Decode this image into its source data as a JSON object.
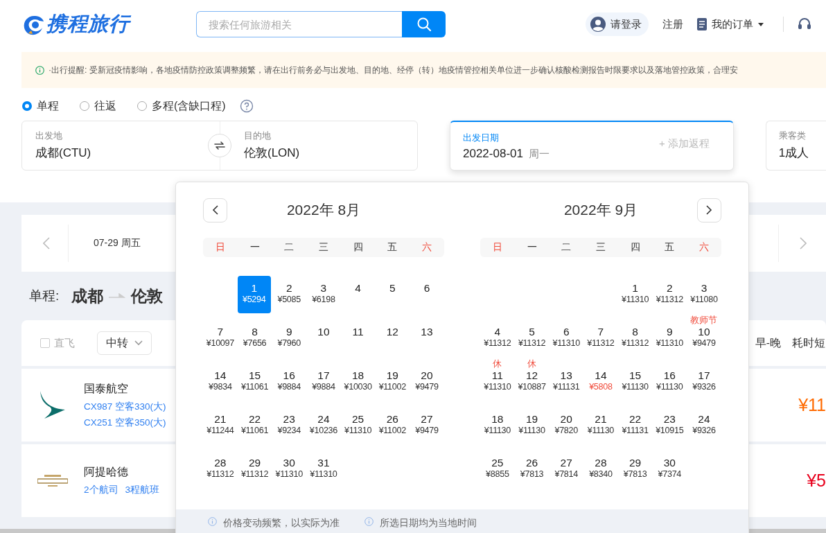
{
  "header": {
    "logo_text": "携程旅行",
    "search": {
      "placeholder": "搜索任何旅游相关"
    },
    "nav": [
      {
        "kind": "login",
        "label": "请登录"
      },
      {
        "kind": "plain",
        "label": "注册"
      },
      {
        "kind": "orders",
        "label": "我的订单"
      }
    ]
  },
  "notice": "·出行提醒: 受新冠疫情影响，各地疫情防控政策调整频繁，请在出行前务必与出发地、目的地、经停（转）地疫情管控相关单位进一步确认核酸检测报告时限要求以及落地管控政策，合理安",
  "trip_types": [
    {
      "label": "单程",
      "selected": true
    },
    {
      "label": "往返",
      "selected": false
    },
    {
      "label": "多程(含缺口程)",
      "selected": false
    }
  ],
  "search_form": {
    "from": {
      "label": "出发地",
      "value": "成都(CTU)"
    },
    "to": {
      "label": "目的地",
      "value": "伦敦(LON)"
    },
    "date": {
      "label": "出发日期",
      "value": "2022-08-01",
      "weekday": "周一",
      "add_return": "+ 添加返程"
    },
    "passengers": {
      "label": "乘客类",
      "value": "1成人"
    }
  },
  "date_strip": [
    {
      "date": "07-29 周五"
    }
  ],
  "route_heading": {
    "prefix": "单程:",
    "from": "成都",
    "to": "伦敦"
  },
  "filters": {
    "direct": {
      "label": "直飞",
      "checked": false
    },
    "dropdowns": [
      {
        "label": "中转"
      }
    ],
    "sorts": [
      {
        "label": "早-晚"
      },
      {
        "label": "耗时短"
      }
    ]
  },
  "results": [
    {
      "kind": "cathay",
      "airline": "国泰航空",
      "links": [
        "CX987 空客330(大)",
        "CX251 空客350(大)"
      ],
      "price": "¥11",
      "color": "#ff6a00"
    },
    {
      "kind": "etihad",
      "airline": "阿提哈德",
      "links": [
        "2个航司",
        "3程航班"
      ],
      "price": "¥5",
      "color": "#e8001c"
    }
  ],
  "calendar": {
    "months": [
      {
        "title": "2022年 8月",
        "kind": "prev",
        "weekdays": [
          "日",
          "一",
          "二",
          "三",
          "四",
          "五",
          "六"
        ],
        "days": [
          {
            "kind": "blank"
          },
          {
            "kind": "day",
            "day": "1",
            "price": "¥5294",
            "selected": true,
            "low": false
          },
          {
            "kind": "day",
            "day": "2",
            "price": "¥5085",
            "selected": false,
            "low": false
          },
          {
            "kind": "day",
            "day": "3",
            "price": "¥6198",
            "selected": false,
            "low": false
          },
          {
            "kind": "day",
            "day": "4",
            "selected": false
          },
          {
            "kind": "day",
            "day": "5",
            "selected": false
          },
          {
            "kind": "day",
            "day": "6",
            "selected": false
          },
          {
            "kind": "day",
            "day": "7",
            "price": "¥10097",
            "selected": false,
            "low": false
          },
          {
            "kind": "day",
            "day": "8",
            "price": "¥7656",
            "selected": false,
            "low": false
          },
          {
            "kind": "day",
            "day": "9",
            "price": "¥7960",
            "selected": false,
            "low": false
          },
          {
            "kind": "day",
            "day": "10",
            "selected": false
          },
          {
            "kind": "day",
            "day": "11",
            "selected": false
          },
          {
            "kind": "day",
            "day": "12",
            "selected": false
          },
          {
            "kind": "day",
            "day": "13",
            "selected": false
          },
          {
            "kind": "day",
            "day": "14",
            "price": "¥9834",
            "selected": false,
            "low": false
          },
          {
            "kind": "day",
            "day": "15",
            "price": "¥11061",
            "selected": false,
            "low": false
          },
          {
            "kind": "day",
            "day": "16",
            "price": "¥9884",
            "selected": false,
            "low": false
          },
          {
            "kind": "day",
            "day": "17",
            "price": "¥9884",
            "selected": false,
            "low": false
          },
          {
            "kind": "day",
            "day": "18",
            "price": "¥10030",
            "selected": false,
            "low": false
          },
          {
            "kind": "day",
            "day": "19",
            "price": "¥11002",
            "selected": false,
            "low": false
          },
          {
            "kind": "day",
            "day": "20",
            "price": "¥9479",
            "selected": false,
            "low": false
          },
          {
            "kind": "day",
            "day": "21",
            "price": "¥11244",
            "selected": false,
            "low": false
          },
          {
            "kind": "day",
            "day": "22",
            "price": "¥11061",
            "selected": false,
            "low": false
          },
          {
            "kind": "day",
            "day": "23",
            "price": "¥9234",
            "selected": false,
            "low": false
          },
          {
            "kind": "day",
            "day": "24",
            "price": "¥10236",
            "selected": false,
            "low": false
          },
          {
            "kind": "day",
            "day": "25",
            "price": "¥11310",
            "selected": false,
            "low": false
          },
          {
            "kind": "day",
            "day": "26",
            "price": "¥11002",
            "selected": false,
            "low": false
          },
          {
            "kind": "day",
            "day": "27",
            "price": "¥9479",
            "selected": false,
            "low": false
          },
          {
            "kind": "day",
            "day": "28",
            "price": "¥11312",
            "selected": false,
            "low": false
          },
          {
            "kind": "day",
            "day": "29",
            "price": "¥11312",
            "selected": false,
            "low": false
          },
          {
            "kind": "day",
            "day": "30",
            "price": "¥11310",
            "selected": false,
            "low": false
          },
          {
            "kind": "day",
            "day": "31",
            "price": "¥11310",
            "selected": false,
            "low": false
          }
        ]
      },
      {
        "title": "2022年 9月",
        "kind": "next",
        "weekdays": [
          "日",
          "一",
          "二",
          "三",
          "四",
          "五",
          "六"
        ],
        "days": [
          {
            "kind": "blank"
          },
          {
            "kind": "blank"
          },
          {
            "kind": "blank"
          },
          {
            "kind": "blank"
          },
          {
            "kind": "day",
            "day": "1",
            "price": "¥11310",
            "selected": false,
            "low": false
          },
          {
            "kind": "day",
            "day": "2",
            "price": "¥11312",
            "selected": false,
            "low": false
          },
          {
            "kind": "day",
            "day": "3",
            "price": "¥11080",
            "selected": false,
            "low": false
          },
          {
            "kind": "day",
            "day": "4",
            "price": "¥11312",
            "selected": false,
            "low": false
          },
          {
            "kind": "day",
            "day": "5",
            "price": "¥11312",
            "selected": false,
            "low": false
          },
          {
            "kind": "day",
            "day": "6",
            "price": "¥11310",
            "selected": false,
            "low": false
          },
          {
            "kind": "day",
            "day": "7",
            "price": "¥11312",
            "selected": false,
            "low": false
          },
          {
            "kind": "day",
            "day": "8",
            "price": "¥11312",
            "selected": false,
            "low": false
          },
          {
            "kind": "day",
            "day": "9",
            "price": "¥11310",
            "selected": false,
            "low": false
          },
          {
            "kind": "day",
            "day": "10",
            "price": "¥9479",
            "note": "教师节",
            "selected": false,
            "low": false
          },
          {
            "kind": "day",
            "day": "11",
            "price": "¥11310",
            "note": "休",
            "selected": false,
            "low": false
          },
          {
            "kind": "day",
            "day": "12",
            "price": "¥10887",
            "note": "休",
            "selected": false,
            "low": false
          },
          {
            "kind": "day",
            "day": "13",
            "price": "¥11131",
            "selected": false,
            "low": false
          },
          {
            "kind": "day",
            "day": "14",
            "price": "¥5808",
            "selected": false,
            "low": true
          },
          {
            "kind": "day",
            "day": "15",
            "price": "¥11130",
            "selected": false,
            "low": false
          },
          {
            "kind": "day",
            "day": "16",
            "price": "¥11130",
            "selected": false,
            "low": false
          },
          {
            "kind": "day",
            "day": "17",
            "price": "¥9326",
            "selected": false,
            "low": false
          },
          {
            "kind": "day",
            "day": "18",
            "price": "¥11130",
            "selected": false,
            "low": false
          },
          {
            "kind": "day",
            "day": "19",
            "price": "¥11130",
            "selected": false,
            "low": false
          },
          {
            "kind": "day",
            "day": "20",
            "price": "¥7820",
            "selected": false,
            "low": false
          },
          {
            "kind": "day",
            "day": "21",
            "price": "¥11130",
            "selected": false,
            "low": false
          },
          {
            "kind": "day",
            "day": "22",
            "price": "¥11131",
            "selected": false,
            "low": false
          },
          {
            "kind": "day",
            "day": "23",
            "price": "¥10915",
            "selected": false,
            "low": false
          },
          {
            "kind": "day",
            "day": "24",
            "price": "¥9326",
            "selected": false,
            "low": false
          },
          {
            "kind": "day",
            "day": "25",
            "price": "¥8855",
            "selected": false,
            "low": false
          },
          {
            "kind": "day",
            "day": "26",
            "price": "¥7813",
            "selected": false,
            "low": false
          },
          {
            "kind": "day",
            "day": "27",
            "price": "¥7814",
            "selected": false,
            "low": false
          },
          {
            "kind": "day",
            "day": "28",
            "price": "¥8340",
            "selected": false,
            "low": false
          },
          {
            "kind": "day",
            "day": "29",
            "price": "¥7813",
            "selected": false,
            "low": false
          },
          {
            "kind": "day",
            "day": "30",
            "price": "¥7374",
            "selected": false,
            "low": false
          }
        ]
      }
    ],
    "footer_notes": [
      "价格变动频繁，以实际为准",
      "所选日期均为当地时间"
    ]
  }
}
